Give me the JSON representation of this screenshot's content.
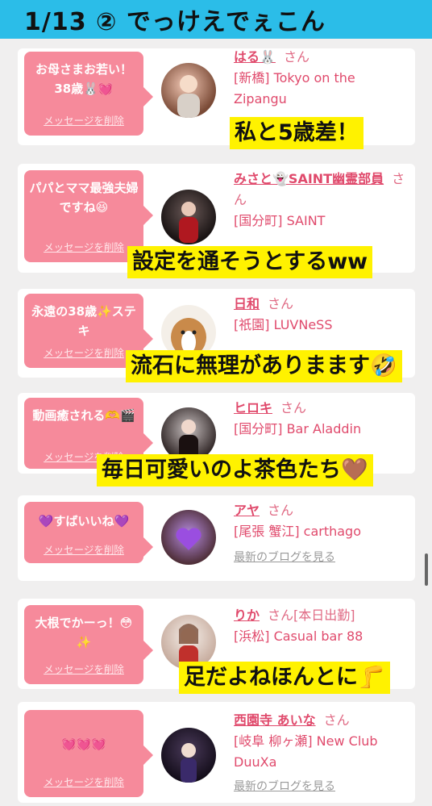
{
  "page_title": "1/13 ② でっけえでぇこん",
  "delete_label": "メッセージを削除",
  "blog_label": "最新のブログを見る",
  "san": "さん",
  "cards": [
    {
      "message": "お母さまお若い！38歳🐰💓",
      "name": "はる🐰",
      "shop": "[新橋] Tokyo on the Zipangu",
      "caption": "私と5歳差！"
    },
    {
      "message": "パパとママ最強夫婦ですね😆",
      "name": "みさと👻SAINT幽霊部員",
      "shop": "[国分町] SAINT",
      "caption": "設定を通そうとするww"
    },
    {
      "message": "永遠の38歳✨ステキ",
      "name": "日和",
      "shop": "[祇園] LUVNeSS",
      "caption": "流石に無理がありまます🤣"
    },
    {
      "message": "動画癒される🫶🎬",
      "name": "ヒロキ",
      "shop": "[国分町] Bar Aladdin",
      "caption": "毎日可愛いのよ茶色たち🤎"
    },
    {
      "message": "💜すばいいね💜",
      "name": "アヤ",
      "shop": "[尾張 蟹江] carthago"
    },
    {
      "message": "大根でかーっ！😳✨",
      "name": "りか",
      "name_suffix": "[本日出勤]",
      "shop": "[浜松] Casual bar 88",
      "caption": "足だよねほんとに🦵"
    },
    {
      "message": "💓💓💓",
      "name": "西園寺 あいな",
      "shop": "[岐阜 柳ヶ瀬] New Club DuuXa"
    }
  ],
  "colors": {
    "accent": "#e04a6c",
    "bubble": "#f68a9b",
    "title_bg": "#2bbde8",
    "caption_bg": "#fff200"
  }
}
